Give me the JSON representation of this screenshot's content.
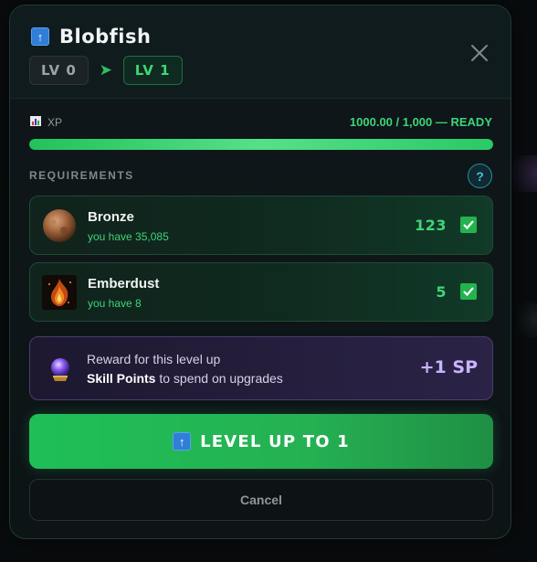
{
  "dialog": {
    "title": "Blobfish",
    "title_icon": "up-arrow-icon",
    "level_from": "LV 0",
    "level_to": "LV 1",
    "close_icon": "close-icon"
  },
  "xp": {
    "label": "XP",
    "icon": "chart-icon",
    "value_text": "1000.00 / 1,000 — READY",
    "progress": 1.0
  },
  "requirements": {
    "label": "REQUIREMENTS",
    "help_label": "?",
    "items": [
      {
        "name": "Bronze",
        "have": "you have 35,085",
        "count": "123",
        "met": true,
        "icon": "bronze-ore-icon"
      },
      {
        "name": "Emberdust",
        "have": "you have 8",
        "count": "5",
        "met": true,
        "icon": "emberdust-icon"
      }
    ]
  },
  "reward": {
    "title": "Reward for this level up",
    "desc_bold": "Skill Points",
    "desc_rest": " to spend on upgrades",
    "value": "+1 SP",
    "icon": "crystal-orb-icon"
  },
  "actions": {
    "level_up_label": "LEVEL UP TO 1",
    "cancel_label": "Cancel"
  },
  "colors": {
    "accent_green": "#3fd478",
    "reward_purple": "#cbb3ff",
    "button_green": "#1fbf58"
  }
}
